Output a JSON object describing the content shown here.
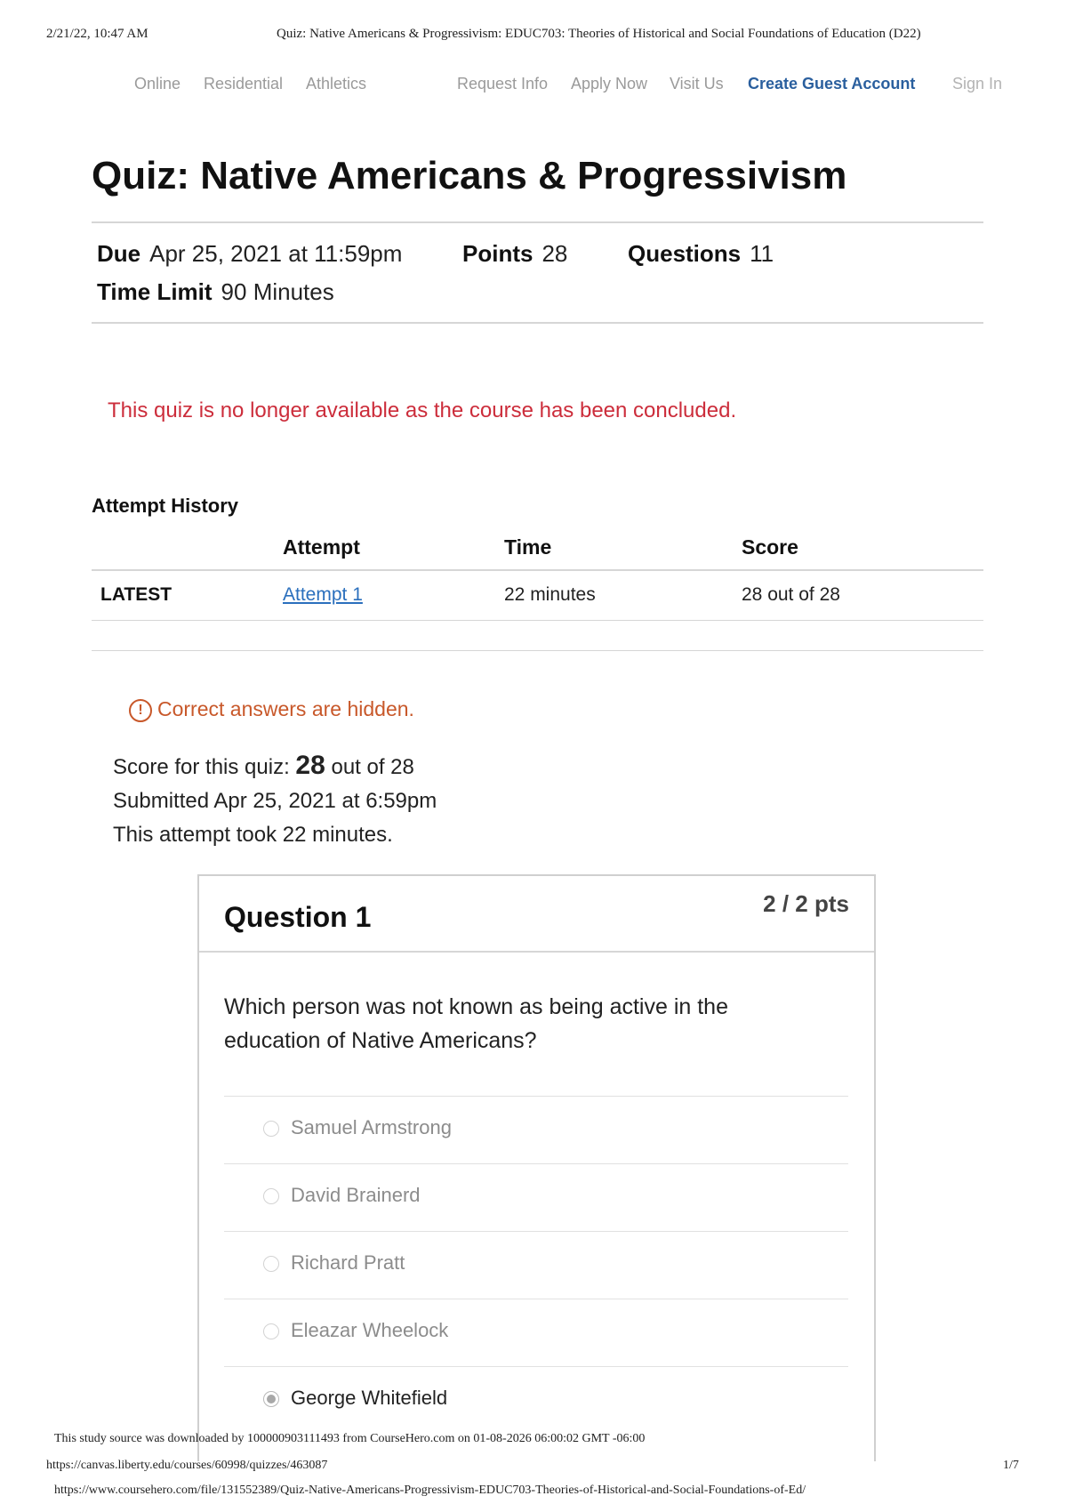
{
  "print_header": {
    "date": "2/21/22, 10:47 AM",
    "title": "Quiz: Native Americans & Progressivism: EDUC703: Theories of Historical and Social Foundations of Education (D22)"
  },
  "nav": {
    "items": [
      "Online",
      "Residential",
      "Athletics",
      "Request Info",
      "Apply Now",
      "Visit Us",
      "Create Guest Account",
      "Sign In"
    ]
  },
  "quiz": {
    "title": "Quiz: Native Americans & Progressivism",
    "due_label": "Due",
    "due_value": "Apr 25, 2021 at 11:59pm",
    "points_label": "Points",
    "points_value": "28",
    "questions_label": "Questions",
    "questions_value": "11",
    "time_limit_label": "Time Limit",
    "time_limit_value": "90 Minutes",
    "unavailable_message": "This quiz is no longer available as the course has been concluded."
  },
  "attempt_history": {
    "heading": "Attempt History",
    "columns": [
      "Attempt",
      "Time",
      "Score"
    ],
    "rows": [
      {
        "label": "LATEST",
        "attempt": "Attempt 1",
        "time": "22 minutes",
        "score": "28 out of 28"
      }
    ]
  },
  "result": {
    "hidden_note": "Correct answers are hidden.",
    "score_prefix": "Score for this quiz:",
    "score_value": "28",
    "score_suffix": "out of 28",
    "submitted": "Submitted Apr 25, 2021 at 6:59pm",
    "duration": "This attempt took 22 minutes."
  },
  "question": {
    "name": "Question 1",
    "points": "2 / 2 pts",
    "text": "Which person was not known as being active in the education of Native Americans?",
    "answers": [
      {
        "label": "Samuel Armstrong",
        "selected": false
      },
      {
        "label": "David Brainerd",
        "selected": false
      },
      {
        "label": "Richard Pratt",
        "selected": false
      },
      {
        "label": "Eleazar Wheelock",
        "selected": false
      },
      {
        "label": "George Whitefield",
        "selected": true
      }
    ]
  },
  "footer": {
    "watermark": "This study source was downloaded by 100000903111493 from CourseHero.com on 01-08-2026 06:00:02 GMT -06:00",
    "url": "https://canvas.liberty.edu/courses/60998/quizzes/463087",
    "page": "1/7",
    "source_url": "https://www.coursehero.com/file/131552389/Quiz-Native-Americans-Progressivism-EDUC703-Theories-of-Historical-and-Social-Foundations-of-Ed/"
  }
}
